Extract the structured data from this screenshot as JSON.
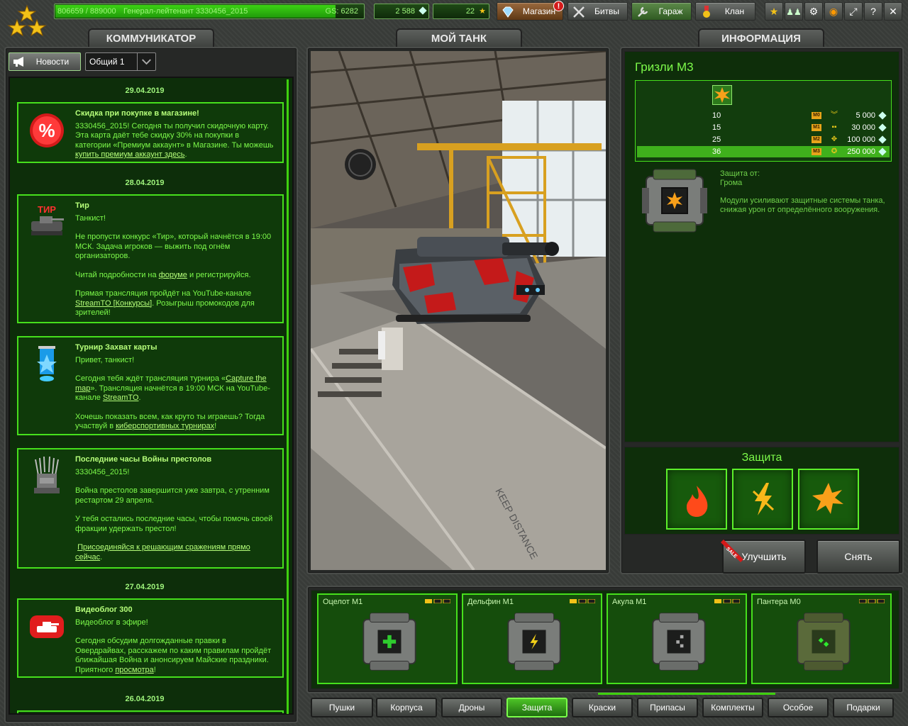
{
  "header": {
    "experience": "806659 / 889000",
    "experience_progress": 0.907,
    "rank": "Генерал-лейтенант 3330456_2015",
    "gs": "GS: 6282",
    "crystals": "2 588",
    "stars": "22",
    "nav": {
      "shop": "Магазин",
      "shop_badge": "!",
      "battles": "Битвы",
      "garage": "Гараж",
      "clan": "Клан"
    },
    "icons": [
      "star-achievements-icon",
      "friends-icon",
      "settings-icon",
      "sound-icon",
      "fullscreen-icon",
      "help-icon"
    ],
    "help_label": "?"
  },
  "panels": {
    "communicator": "КОММУНИКАТОР",
    "my_tank": "МОЙ ТАНК",
    "info": "ИНФОРМАЦИЯ"
  },
  "communicator": {
    "news_button": "Новости",
    "channel": "Общий 1",
    "feed": [
      {
        "date": "29.04.2019",
        "title": "Скидка при покупке в магазине!",
        "icon": "discount-percent-icon",
        "text": "3330456_2015! Сегодня ты получил скидочную карту. Эта карта даёт тебе скидку 30% на покупки в категории «Премиум аккаунт» в Магазине. Ты можешь",
        "link": "купить премиум аккаунт здесь",
        "after": "."
      },
      {
        "date": "28.04.2019",
        "title": "Тир",
        "icon": "shooting-range-icon",
        "icon_text": "ТИР",
        "greeting": "Танкист!",
        "p1": "Не пропусти конкурс «Тир», который начнётся в 19:00 МСК. Задача игроков — выжить под огнём организаторов.",
        "p2_before": "Читай подробности на ",
        "p2_link": "форуме",
        "p2_after": " и регистрируйся.",
        "p3_before": "Прямая трансляция пройдёт на YouTube-канале ",
        "p3_link": "StreamTO [Конкурсы]",
        "p3_after": ". Розыгрыш промокодов для зрителей!"
      },
      {
        "title": "Турнир Захват карты",
        "icon": "tournament-flag-icon",
        "greeting": "Привет, танкист!",
        "p1_before": " Сегодня тебя ждёт трансляция турнира «",
        "p1_link": "Capture the map",
        "p1_mid": "». Трансляция начнётся в 19:00 МСК на YouTube-канале ",
        "p1_link2": "StreamTO",
        "p1_after": ".",
        "p2_before": "Хочешь показать всем, как круто ты играешь? Тогда участвуй в ",
        "p2_link": "киберспортивных турнирах",
        "p2_after": "!"
      },
      {
        "title": "Последние часы Войны престолов",
        "icon": "iron-throne-icon",
        "greeting": "3330456_2015!",
        "p1": "Война престолов завершится уже завтра, с утренним рестартом 29 апреля.",
        "p2": "У тебя остались последние часы, чтобы помочь своей фракции удержать престол!",
        "link": "Присоединяйся к решающим сражениям прямо сейчас",
        "after": "."
      },
      {
        "date": "27.04.2019",
        "title": "Видеоблог 300",
        "icon": "youtube-tank-icon",
        "greeting": "Видеоблог в эфире!",
        "p1_before": "Сегодня обсудим долгожданные правки в Овердрайвах, расскажем по каким правилам пройдёт ближайшая Война и анонсируем Майские праздники. Приятного ",
        "p1_link": "просмотра",
        "p1_after": "!"
      },
      {
        "date": "26.04.2019"
      }
    ]
  },
  "info": {
    "title": "Гризли М3",
    "upgrades": [
      {
        "level": "10",
        "mark": "M0",
        "price": "5 000"
      },
      {
        "level": "15",
        "mark": "M1",
        "price": "30 000"
      },
      {
        "level": "25",
        "mark": "M2",
        "price": "100 000"
      },
      {
        "level": "36",
        "mark": "M3",
        "price": "250 000",
        "active": true
      }
    ],
    "protection_from_label": "Защита от:",
    "protection_from": "Грома",
    "description": "Модули усиливают защитные системы танка, снижая урон от определённого вооружения.",
    "protection_title": "Защита",
    "protection_slots": [
      "fire-icon",
      "lightning-bolt-icon",
      "explosion-icon"
    ],
    "upgrade_button": "Улучшить",
    "remove_button": "Снять",
    "sale_label": "SALE"
  },
  "inventory": [
    {
      "name": "Оцелот М1",
      "icon": "plus-icon"
    },
    {
      "name": "Дельфин М1",
      "icon": "lightning-icon"
    },
    {
      "name": "Акула М1",
      "icon": "dots-icon"
    },
    {
      "name": "Пантера М0",
      "icon": "diamonds-icon"
    }
  ],
  "categories": [
    {
      "label": "Пушки"
    },
    {
      "label": "Корпуса"
    },
    {
      "label": "Дроны"
    },
    {
      "label": "Защита",
      "active": true
    },
    {
      "label": "Краски"
    },
    {
      "label": "Припасы"
    },
    {
      "label": "Комплекты"
    },
    {
      "label": "Особое"
    },
    {
      "label": "Подарки"
    }
  ]
}
